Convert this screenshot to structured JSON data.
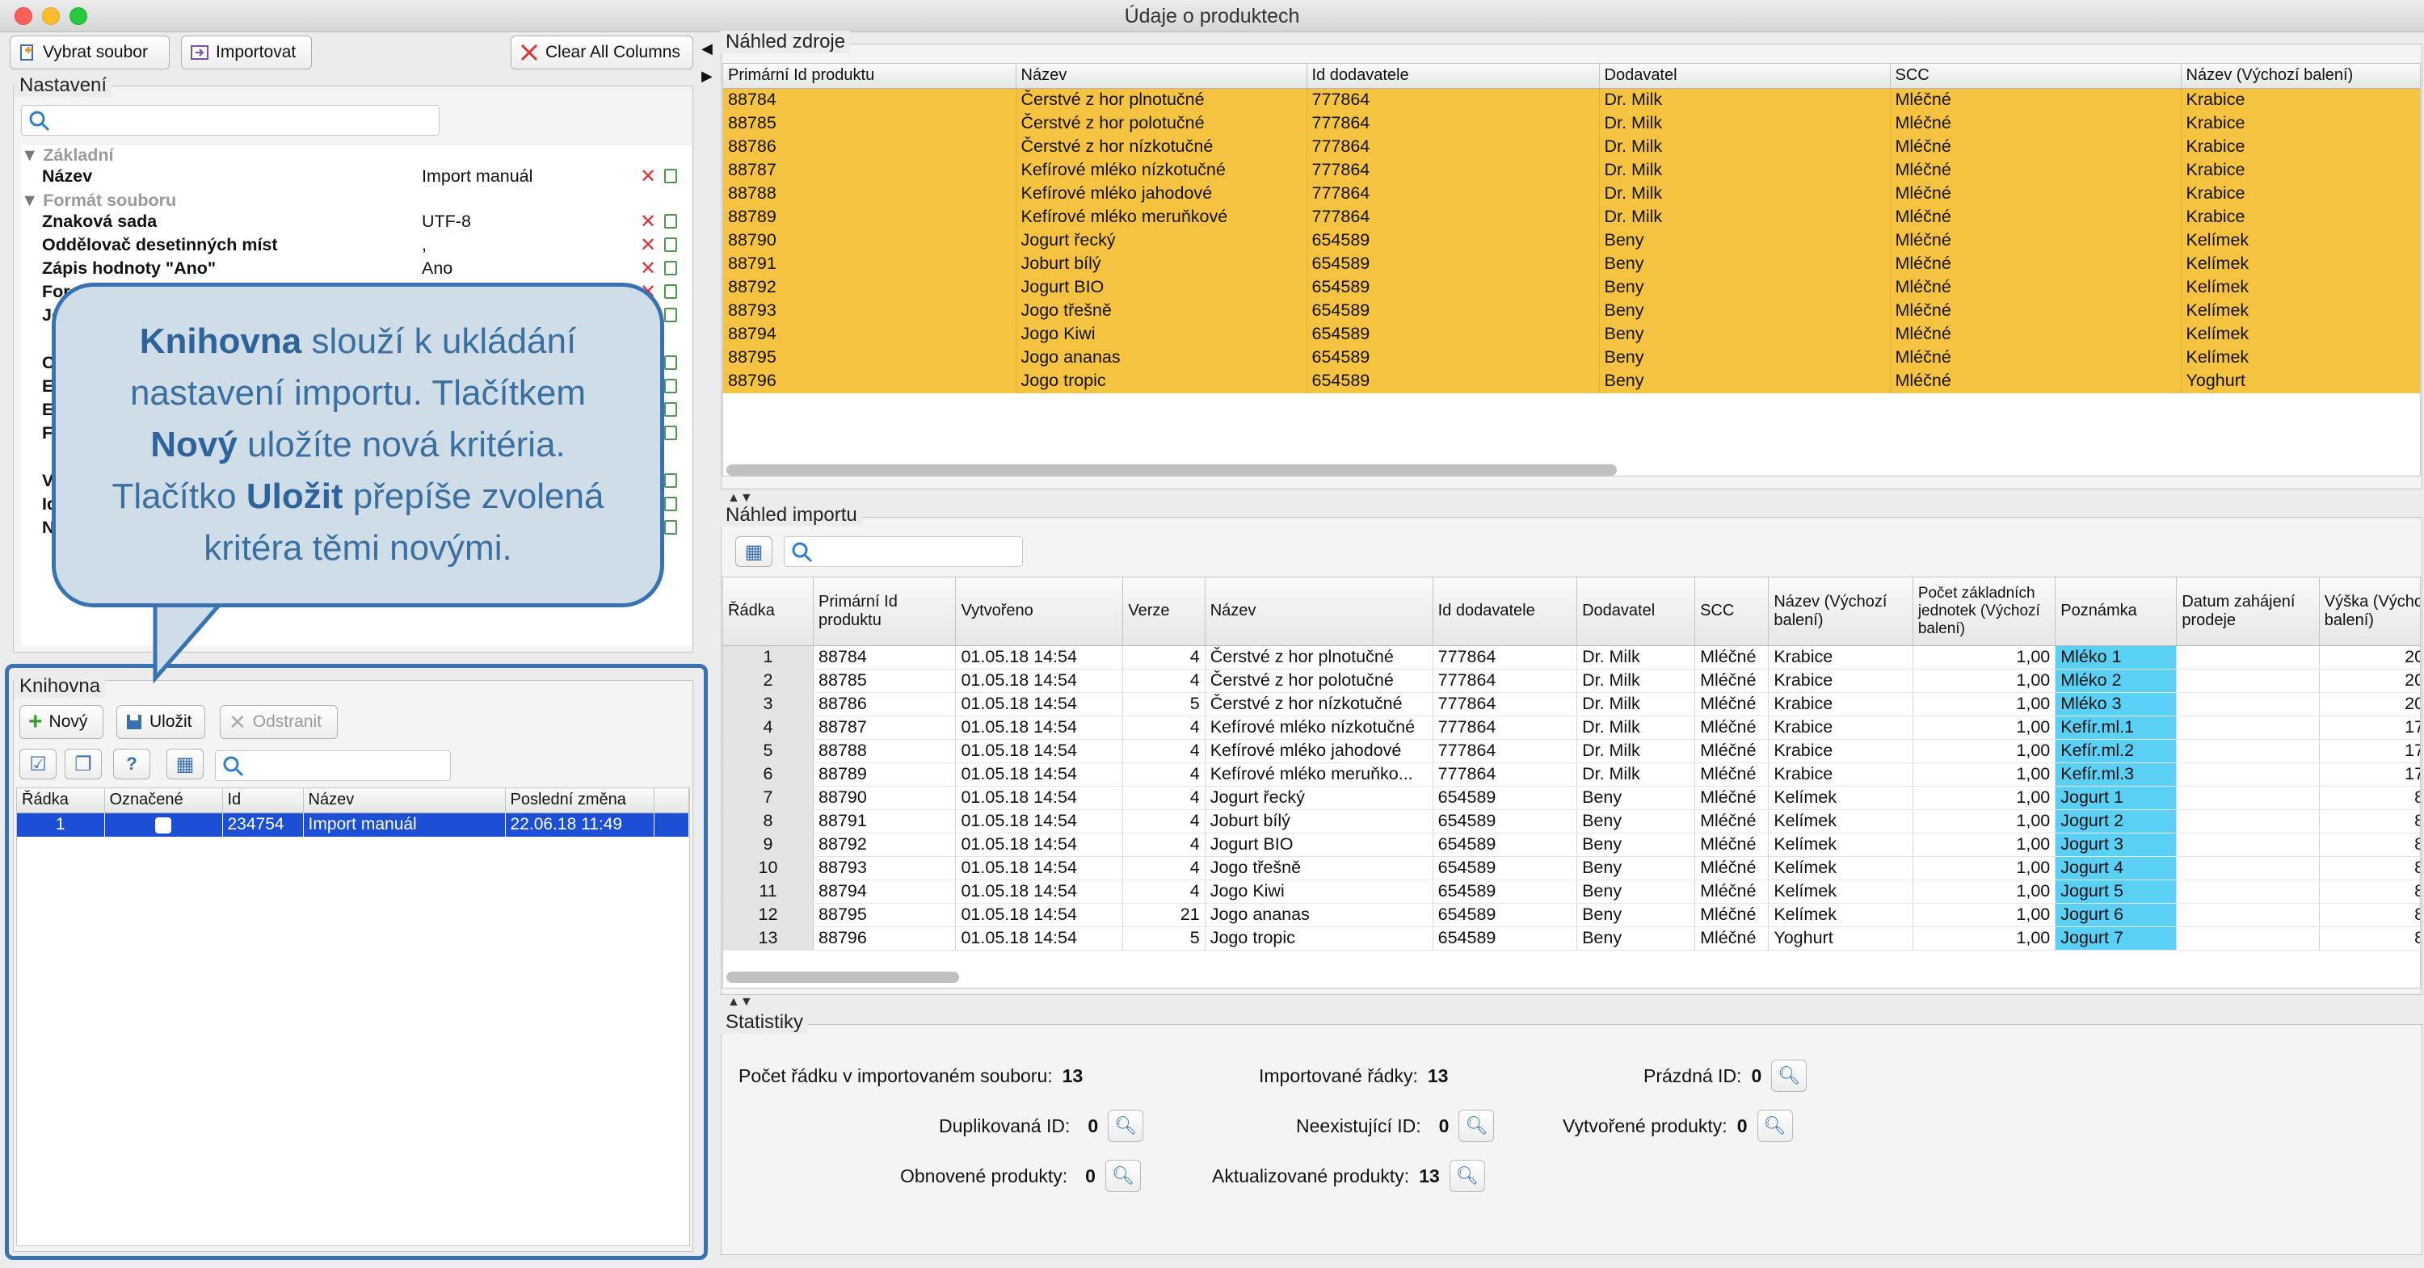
{
  "window": {
    "title": "Údaje o produktech"
  },
  "toolbar": {
    "select_file": "Vybrat soubor",
    "import": "Importovat",
    "clear_columns": "Clear All Columns"
  },
  "settings": {
    "title": "Nastavení",
    "categories": [
      "Základní",
      "Formát souboru"
    ],
    "rows": [
      {
        "key": "Název",
        "value": "Import manuál"
      },
      {
        "key": "Znaková sada",
        "value": "UTF-8"
      },
      {
        "key": "Oddělovač desetinných míst",
        "value": ","
      },
      {
        "key": "Zápis hodnoty \"Ano\"",
        "value": "Ano"
      },
      {
        "key": "For",
        "value": ""
      },
      {
        "key": "Je",
        "value": ""
      }
    ],
    "hidden_letters": [
      "C",
      "E",
      "E",
      "F",
      "P",
      "V",
      "Id",
      "N"
    ]
  },
  "callout": {
    "parts": [
      {
        "bold": true,
        "text": "Knihovna"
      },
      {
        "bold": false,
        "text": " slouží k ukládání nastavení importu. Tlačítkem "
      },
      {
        "bold": true,
        "text": "Nový"
      },
      {
        "bold": false,
        "text": " uložíte nová kritéria. Tlačítko "
      },
      {
        "bold": true,
        "text": "Uložit"
      },
      {
        "bold": false,
        "text": " přepíše zvolená kritéra těmi novými."
      }
    ]
  },
  "library": {
    "title": "Knihovna",
    "new": "Nový",
    "save": "Uložit",
    "remove": "Odstranit",
    "columns": [
      "Řádka",
      "Označené",
      "Id",
      "Název",
      "Poslední změna"
    ],
    "rows": [
      {
        "row": "1",
        "checked": false,
        "id": "234754",
        "name": "Import manuál",
        "changed": "22.06.18 11:49"
      }
    ]
  },
  "source": {
    "title": "Náhled zdroje",
    "columns": [
      "Primární Id produktu",
      "Název",
      "Id dodavatele",
      "Dodavatel",
      "SCC",
      "Název (Výchozí balení)"
    ],
    "rows": [
      [
        "88784",
        "Čerstvé z hor plnotučné",
        "777864",
        "Dr. Milk",
        "Mléčné",
        "Krabice"
      ],
      [
        "88785",
        "Čerstvé z hor polotučné",
        "777864",
        "Dr. Milk",
        "Mléčné",
        "Krabice"
      ],
      [
        "88786",
        "Čerstvé z hor nízkotučné",
        "777864",
        "Dr. Milk",
        "Mléčné",
        "Krabice"
      ],
      [
        "88787",
        "Kefírové mléko nízkotučné",
        "777864",
        "Dr. Milk",
        "Mléčné",
        "Krabice"
      ],
      [
        "88788",
        "Kefírové mléko jahodové",
        "777864",
        "Dr. Milk",
        "Mléčné",
        "Krabice"
      ],
      [
        "88789",
        "Kefírové mléko meruňkové",
        "777864",
        "Dr. Milk",
        "Mléčné",
        "Krabice"
      ],
      [
        "88790",
        "Jogurt řecký",
        "654589",
        "Beny",
        "Mléčné",
        "Kelímek"
      ],
      [
        "88791",
        "Joburt bílý",
        "654589",
        "Beny",
        "Mléčné",
        "Kelímek"
      ],
      [
        "88792",
        "Jogurt BIO",
        "654589",
        "Beny",
        "Mléčné",
        "Kelímek"
      ],
      [
        "88793",
        "Jogo třešně",
        "654589",
        "Beny",
        "Mléčné",
        "Kelímek"
      ],
      [
        "88794",
        "Jogo Kiwi",
        "654589",
        "Beny",
        "Mléčné",
        "Kelímek"
      ],
      [
        "88795",
        "Jogo ananas",
        "654589",
        "Beny",
        "Mléčné",
        "Kelímek"
      ],
      [
        "88796",
        "Jogo tropic",
        "654589",
        "Beny",
        "Mléčné",
        "Yoghurt"
      ]
    ]
  },
  "import": {
    "title": "Náhled importu",
    "columns": [
      "Řádka",
      "Primární Id produktu",
      "Vytvořeno",
      "Verze",
      "Název",
      "Id dodavatele",
      "Dodavatel",
      "SCC",
      "Název (Výchozí balení)",
      "Počet základních jednotek (Výchozí balení)",
      "Poznámka",
      "Datum zahájení prodeje",
      "Výška (Výchoz balení)"
    ],
    "rows": [
      [
        "1",
        "88784",
        "01.05.18 14:54",
        "4",
        "Čerstvé z hor plnotučné",
        "777864",
        "Dr. Milk",
        "Mléčné",
        "Krabice",
        "1,00",
        "Mléko 1",
        "",
        "20,0"
      ],
      [
        "2",
        "88785",
        "01.05.18 14:54",
        "4",
        "Čerstvé z hor polotučné",
        "777864",
        "Dr. Milk",
        "Mléčné",
        "Krabice",
        "1,00",
        "Mléko 2",
        "",
        "20,0"
      ],
      [
        "3",
        "88786",
        "01.05.18 14:54",
        "5",
        "Čerstvé z hor nízkotučné",
        "777864",
        "Dr. Milk",
        "Mléčné",
        "Krabice",
        "1,00",
        "Mléko 3",
        "",
        "20,0"
      ],
      [
        "4",
        "88787",
        "01.05.18 14:54",
        "4",
        "Kefírové mléko nízkotučné",
        "777864",
        "Dr. Milk",
        "Mléčné",
        "Krabice",
        "1,00",
        "Kefír.ml.1",
        "",
        "17,0"
      ],
      [
        "5",
        "88788",
        "01.05.18 14:54",
        "4",
        "Kefírové mléko jahodové",
        "777864",
        "Dr. Milk",
        "Mléčné",
        "Krabice",
        "1,00",
        "Kefír.ml.2",
        "",
        "17,0"
      ],
      [
        "6",
        "88789",
        "01.05.18 14:54",
        "4",
        "Kefírové mléko meruňko...",
        "777864",
        "Dr. Milk",
        "Mléčné",
        "Krabice",
        "1,00",
        "Kefír.ml.3",
        "",
        "17,0"
      ],
      [
        "7",
        "88790",
        "01.05.18 14:54",
        "4",
        "Jogurt řecký",
        "654589",
        "Beny",
        "Mléčné",
        "Kelímek",
        "1,00",
        "Jogurt 1",
        "",
        "8,0"
      ],
      [
        "8",
        "88791",
        "01.05.18 14:54",
        "4",
        "Joburt bílý",
        "654589",
        "Beny",
        "Mléčné",
        "Kelímek",
        "1,00",
        "Jogurt 2",
        "",
        "8,0"
      ],
      [
        "9",
        "88792",
        "01.05.18 14:54",
        "4",
        "Jogurt BIO",
        "654589",
        "Beny",
        "Mléčné",
        "Kelímek",
        "1,00",
        "Jogurt 3",
        "",
        "8,0"
      ],
      [
        "10",
        "88793",
        "01.05.18 14:54",
        "4",
        "Jogo třešně",
        "654589",
        "Beny",
        "Mléčné",
        "Kelímek",
        "1,00",
        "Jogurt 4",
        "",
        "8,0"
      ],
      [
        "11",
        "88794",
        "01.05.18 14:54",
        "4",
        "Jogo Kiwi",
        "654589",
        "Beny",
        "Mléčné",
        "Kelímek",
        "1,00",
        "Jogurt 5",
        "",
        "8,0"
      ],
      [
        "12",
        "88795",
        "01.05.18 14:54",
        "21",
        "Jogo ananas",
        "654589",
        "Beny",
        "Mléčné",
        "Kelímek",
        "1,00",
        "Jogurt 6",
        "",
        "8,0"
      ],
      [
        "13",
        "88796",
        "01.05.18 14:54",
        "5",
        "Jogo tropic",
        "654589",
        "Beny",
        "Mléčné",
        "Yoghurt",
        "1,00",
        "Jogurt 7",
        "",
        "8,0"
      ]
    ]
  },
  "stats": {
    "title": "Statistiky",
    "file_rows_label": "Počet řádku v importovaném souboru:",
    "file_rows": "13",
    "imported_label": "Importované řádky:",
    "imported": "13",
    "empty_id_label": "Prázdná ID:",
    "empty_id": "0",
    "duplicate_label": "Duplikovaná ID:",
    "duplicate": "0",
    "nonexistent_label": "Neexistující ID:",
    "nonexistent": "0",
    "created_label": "Vytvořené produkty:",
    "created": "0",
    "restored_label": "Obnovené produkty:",
    "restored": "0",
    "updated_label": "Aktualizované produkty:",
    "updated": "13"
  },
  "colors": {
    "source_row": "#f5c33f",
    "note_cell": "#5bd0f5",
    "selected_row": "#1c4fd6",
    "callout_border": "#3773b2"
  }
}
